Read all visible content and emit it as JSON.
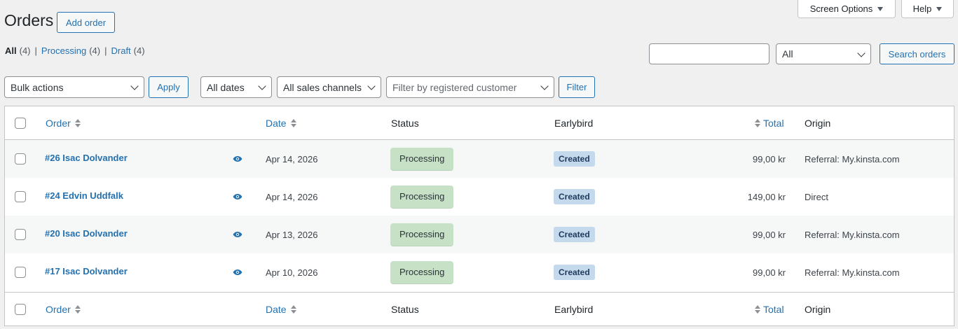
{
  "top_tabs": {
    "screen_options": "Screen Options",
    "help": "Help"
  },
  "page": {
    "title": "Orders",
    "add_order": "Add order"
  },
  "views": [
    {
      "label": "All",
      "count": "(4)",
      "current": true
    },
    {
      "label": "Processing",
      "count": "(4)",
      "current": false
    },
    {
      "label": "Draft",
      "count": "(4)",
      "current": false
    }
  ],
  "views_sep": "|",
  "search": {
    "value": "",
    "scope": "All",
    "button": "Search orders"
  },
  "filters": {
    "bulk_actions": "Bulk actions",
    "apply": "Apply",
    "dates": "All dates",
    "channels": "All sales channels",
    "customer_placeholder": "Filter by registered customer",
    "filter": "Filter"
  },
  "columns": {
    "order": "Order",
    "date": "Date",
    "status": "Status",
    "earlybird": "Earlybird",
    "total": "Total",
    "origin": "Origin"
  },
  "rows": [
    {
      "order": "#26 Isac Dolvander",
      "date": "Apr 14, 2026",
      "status": "Processing",
      "earlybird": "Created",
      "total": "99,00 kr",
      "origin": "Referral: My.kinsta.com"
    },
    {
      "order": "#24 Edvin Uddfalk",
      "date": "Apr 14, 2026",
      "status": "Processing",
      "earlybird": "Created",
      "total": "149,00 kr",
      "origin": "Direct"
    },
    {
      "order": "#20 Isac Dolvander",
      "date": "Apr 13, 2026",
      "status": "Processing",
      "earlybird": "Created",
      "total": "99,00 kr",
      "origin": "Referral: My.kinsta.com"
    },
    {
      "order": "#17 Isac Dolvander",
      "date": "Apr 10, 2026",
      "status": "Processing",
      "earlybird": "Created",
      "total": "99,00 kr",
      "origin": "Referral: My.kinsta.com"
    }
  ],
  "colors": {
    "accent": "#2271b1",
    "status_processing_bg": "#c6e1c6",
    "earlybird_bg": "#c5d9ed",
    "page_bg": "#f0f0f1"
  }
}
